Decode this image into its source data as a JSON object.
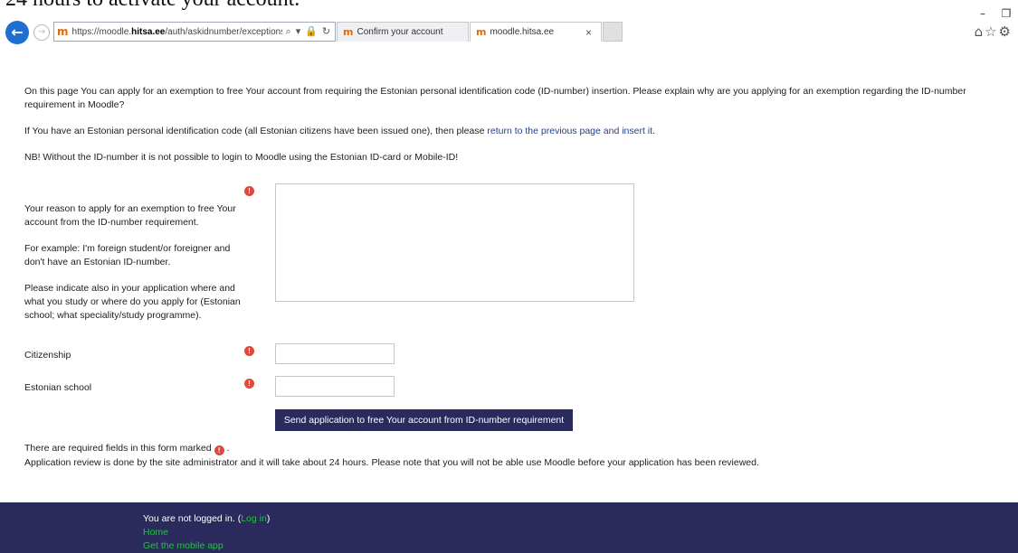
{
  "caption": "24 hours to activate your account.",
  "browser": {
    "url_prefix": "https://moodle.",
    "url_domain": "hitsa.ee",
    "url_suffix": "/auth/askidnumber/exceptions/inse",
    "tabs": [
      {
        "label": "Confirm your account"
      },
      {
        "label": "moodle.hitsa.ee"
      }
    ],
    "site_icon_glyph": "m"
  },
  "intro": {
    "p1": "On this page You can apply for an exemption to free Your account from requiring the Estonian personal identification code (ID-number) insertion. Please explain why are you applying for an exemption regarding the ID-number requirement in Moodle?",
    "p2_before": "If You have an Estonian personal identification code (all Estonian citizens have been issued one), then please ",
    "p2_link": "return to the previous page and insert it",
    "p2_after": ".",
    "p3": "NB! Without the ID-number it is not possible to login to Moodle using the Estonian ID-card or Mobile-ID!"
  },
  "form": {
    "reason_label_1": "Your reason to apply for an exemption to free Your account from the ID-number requirement.",
    "reason_label_2": "For example: I'm foreign student/or foreigner and don't have an Estonian ID-number.",
    "reason_label_3": "Please indicate also in your application where and what you study or where do you apply for (Estonian school; what speciality/study programme).",
    "citizenship_label": "Citizenship",
    "school_label": "Estonian school",
    "submit_label": "Send application to free Your account from ID-number requirement",
    "required_glyph": "!"
  },
  "notes": {
    "required_before": "There are required fields in this form marked",
    "required_after": ".",
    "review": "Application review is done by the site administrator and it will take about 24 hours. Please note that you will not be able use Moodle before your application has been reviewed."
  },
  "footer": {
    "not_logged_in": "You are not logged in. (",
    "login_link": "Log in",
    "close_paren": ")",
    "home_link": "Home",
    "mobile_app_link": "Get the mobile app"
  },
  "colors": {
    "accent": "#2a2a5c",
    "required": "#e0483e",
    "link": "#1f3f8f",
    "footer_link": "#1ec63c"
  }
}
